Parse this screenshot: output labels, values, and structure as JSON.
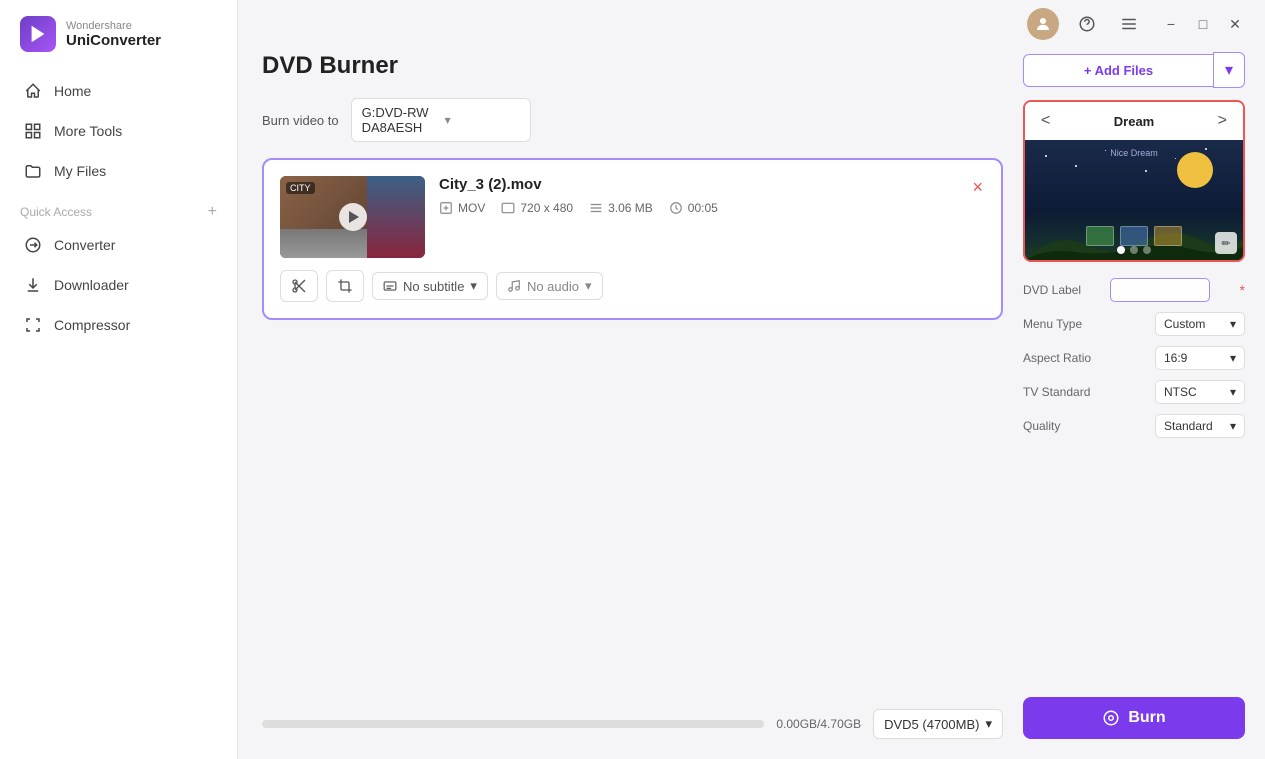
{
  "app": {
    "brand": "Wondershare",
    "name": "UniConverter"
  },
  "titlebar": {
    "icons": [
      "user",
      "headset",
      "menu",
      "minimize",
      "maximize",
      "close"
    ]
  },
  "sidebar": {
    "nav_items": [
      {
        "id": "home",
        "label": "Home"
      },
      {
        "id": "more-tools",
        "label": "More Tools"
      },
      {
        "id": "my-files",
        "label": "My Files"
      }
    ],
    "quick_access_label": "Quick Access",
    "quick_access_items": [
      {
        "id": "converter",
        "label": "Converter"
      },
      {
        "id": "downloader",
        "label": "Downloader"
      },
      {
        "id": "compressor",
        "label": "Compressor"
      }
    ]
  },
  "page": {
    "title": "DVD Burner",
    "burn_to_label": "Burn video to",
    "drive_value": "G:DVD-RW DA8AESH"
  },
  "file": {
    "name": "City_3 (2).mov",
    "format": "MOV",
    "resolution": "720 x 480",
    "size": "3.06 MB",
    "duration": "00:05",
    "subtitle_label": "No subtitle",
    "audio_label": "No audio",
    "delete_label": "×"
  },
  "bottom": {
    "storage_label": "0.00GB/4.70GB",
    "disc_value": "DVD5 (4700MB)"
  },
  "right": {
    "add_files_label": "+ Add Files",
    "theme_prev": "<",
    "theme_next": ">",
    "theme_name": "Dream",
    "theme_preview_text": "Nice Dream",
    "dvd_label_label": "DVD Label",
    "dvd_label_placeholder": "",
    "menu_type_label": "Menu Type",
    "menu_type_value": "Custom",
    "aspect_ratio_label": "Aspect Ratio",
    "aspect_ratio_value": "16:9",
    "tv_standard_label": "TV Standard",
    "tv_standard_value": "NTSC",
    "quality_label": "Quality",
    "quality_value": "Standard",
    "burn_label": "Burn"
  }
}
